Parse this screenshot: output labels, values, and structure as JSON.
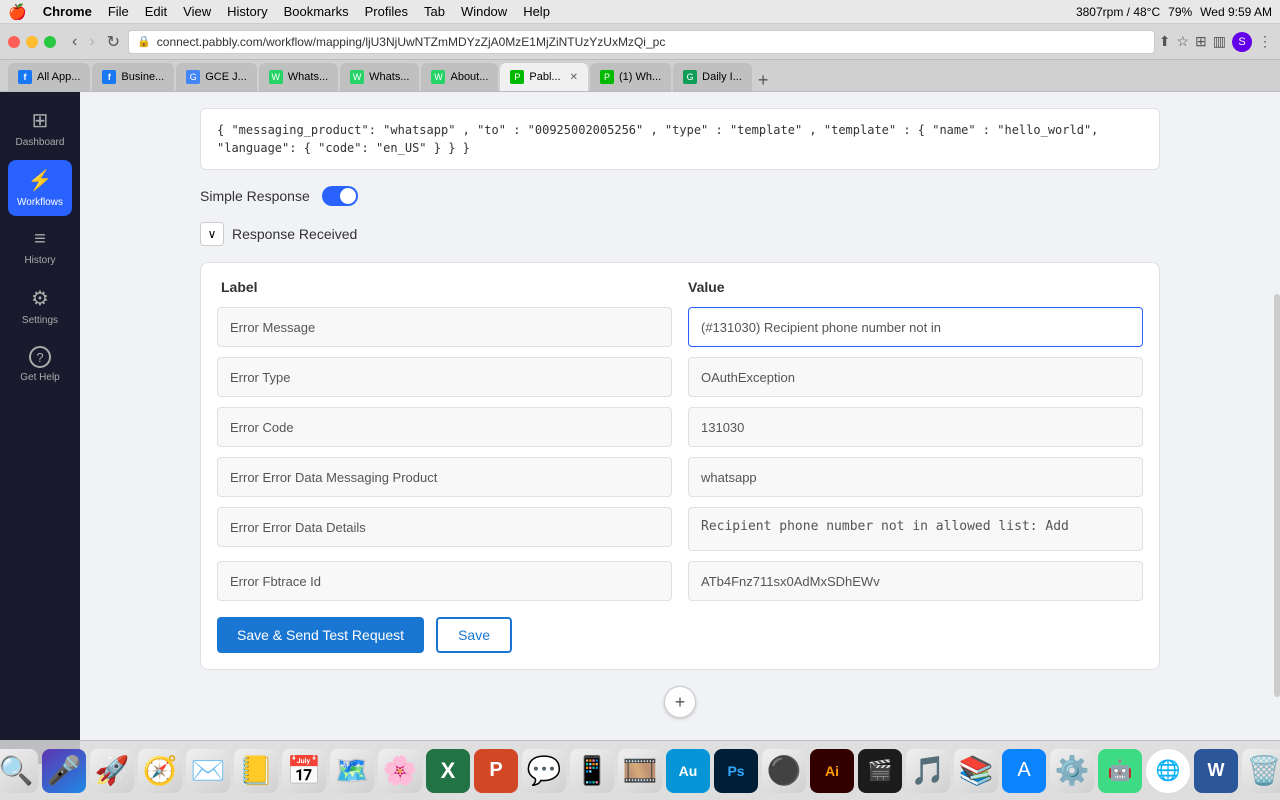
{
  "menubar": {
    "apple": "🍎",
    "items": [
      "Chrome",
      "File",
      "Edit",
      "View",
      "History",
      "Bookmarks",
      "Profiles",
      "Tab",
      "Window",
      "Help"
    ],
    "system": {
      "rpm": "3807rpm / 48°C",
      "battery": "79%",
      "time": "Wed 9:59 AM"
    }
  },
  "browser": {
    "url": "connect.pabbly.com/workflow/mapping/ljU3NjUwNTZmMDYzZjA0MzE1MjZiNTUzYzUxMzQi_pc"
  },
  "tabs": [
    {
      "id": 1,
      "label": "All App...",
      "favicon_color": "#1877f2",
      "favicon_text": "f",
      "active": false
    },
    {
      "id": 2,
      "label": "Busine...",
      "favicon_color": "#1877f2",
      "favicon_text": "f",
      "active": false
    },
    {
      "id": 3,
      "label": "GCE J...",
      "favicon_color": "#4285f4",
      "favicon_text": "G",
      "active": false
    },
    {
      "id": 4,
      "label": "Whats...",
      "favicon_color": "#25d366",
      "favicon_text": "W",
      "active": false
    },
    {
      "id": 5,
      "label": "Whats...",
      "favicon_color": "#25d366",
      "favicon_text": "W",
      "active": false
    },
    {
      "id": 6,
      "label": "About...",
      "favicon_color": "#25d366",
      "favicon_text": "W",
      "active": false
    },
    {
      "id": 7,
      "label": "Pabl...",
      "favicon_color": "#00b900",
      "favicon_text": "P",
      "active": true
    },
    {
      "id": 8,
      "label": "(1) Wh...",
      "favicon_color": "#00b900",
      "favicon_text": "P",
      "active": false
    },
    {
      "id": 9,
      "label": "Daily I...",
      "favicon_color": "#0f9d58",
      "favicon_text": "G",
      "active": false
    }
  ],
  "sidebar": {
    "items": [
      {
        "id": "dashboard",
        "label": "Dashboard",
        "icon": "⊞",
        "active": false
      },
      {
        "id": "workflows",
        "label": "Workflows",
        "icon": "⚡",
        "active": true
      },
      {
        "id": "history",
        "label": "History",
        "icon": "≡",
        "active": false
      },
      {
        "id": "settings",
        "label": "Settings",
        "icon": "⚙",
        "active": false
      },
      {
        "id": "get-help",
        "label": "Get Help",
        "icon": "?",
        "active": false
      }
    ]
  },
  "code_block": {
    "text": "{ \"messaging_product\": \"whatsapp\" , \"to\" : \"00925002005256\" , \"type\" : \"template\" , \"template\" : { \"name\" : \"hello_world\", \"language\": { \"code\": \"en_US\" } } }"
  },
  "simple_response": {
    "label": "Simple Response",
    "enabled": true
  },
  "response_received": {
    "label": "Response Received",
    "expanded": true
  },
  "fields": {
    "label_header": "Label",
    "value_header": "Value",
    "rows": [
      {
        "label": "Error Message",
        "value": "(#131030) Recipient phone number not in",
        "highlighted": true
      },
      {
        "label": "Error Type",
        "value": "OAuthException",
        "highlighted": false
      },
      {
        "label": "Error Code",
        "value": "131030",
        "highlighted": false
      },
      {
        "label": "Error Error Data Messaging Product",
        "value": "whatsapp",
        "highlighted": false
      },
      {
        "label": "Error Error Data Details",
        "value": "Recipient phone number not in allowed list: Add",
        "highlighted": false
      },
      {
        "label": "Error Fbtrace Id",
        "value": "ATb4Fnz711sx0AdMxSDhEWv",
        "highlighted": false
      }
    ]
  },
  "buttons": {
    "save_send": "Save & Send Test Request",
    "save": "Save"
  },
  "add_step": "+"
}
